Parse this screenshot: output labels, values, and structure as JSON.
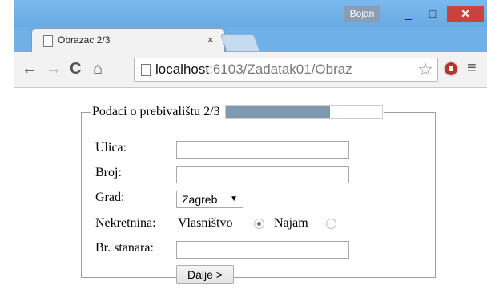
{
  "window": {
    "user": "Bojan",
    "minimize_glyph": "_",
    "maximize_glyph": "□",
    "close_glyph": "✕"
  },
  "tab": {
    "title": "Obrazac 2/3",
    "close_glyph": "×"
  },
  "toolbar": {
    "back_glyph": "←",
    "forward_glyph": "→",
    "reload_glyph": "C",
    "home_glyph": "⌂",
    "url_host": "localhost",
    "url_path": ":6103/Zadatak01/Obraz",
    "star_glyph": "☆",
    "menu_glyph": "≡"
  },
  "form": {
    "legend": "Podaci o prebivalištu 2/3",
    "progress": {
      "value": 0.67,
      "segments": 6
    },
    "fields": {
      "ulica_label": "Ulica:",
      "ulica_value": "",
      "broj_label": "Broj:",
      "broj_value": "",
      "grad_label": "Grad:",
      "grad_selected": "Zagreb",
      "nekretnina_label": "Nekretnina:",
      "option_vlasnistvo": "Vlasništvo",
      "option_najam": "Najam",
      "selected_option": "Vlasništvo",
      "stanara_label": "Br. stanara:",
      "stanara_value": ""
    },
    "submit_label": "Dalje >"
  },
  "icons": {
    "tab_page": "page-icon",
    "url_page": "page-icon",
    "extension": "stop-sign-icon"
  }
}
